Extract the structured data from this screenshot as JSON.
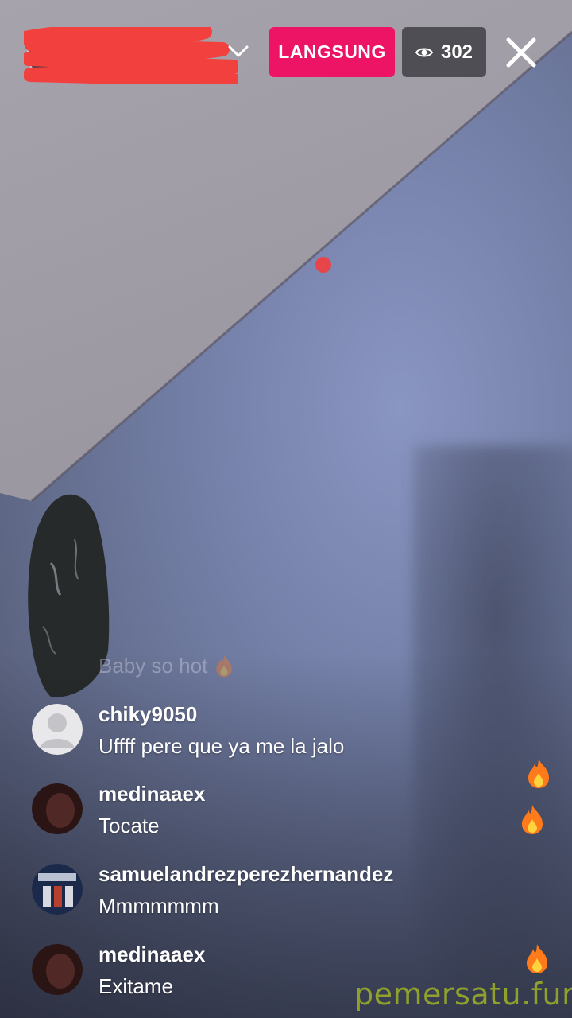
{
  "top_bar": {
    "live_label": "LANGSUNG",
    "viewer_count": "302"
  },
  "comments": {
    "ghost": {
      "text": "Baby so hot"
    },
    "items": [
      {
        "user": "chiky9050",
        "text": "Uffff pere que ya me la jalo"
      },
      {
        "user": "medinaaex",
        "text": "Tocate"
      },
      {
        "user": "samuelandrezperezhernandez",
        "text": "Mmmmmmm"
      },
      {
        "user": "medinaaex",
        "text": "Exitame"
      }
    ]
  },
  "watermark": "pemersatu.fun",
  "colors": {
    "live_badge": "#ed1466",
    "redaction": "#f2403f",
    "flame": "#ff7a1a"
  },
  "icons": {
    "chevron": "chevron-down-icon",
    "eye": "eye-icon",
    "close": "close-icon",
    "flame": "flame-icon"
  }
}
